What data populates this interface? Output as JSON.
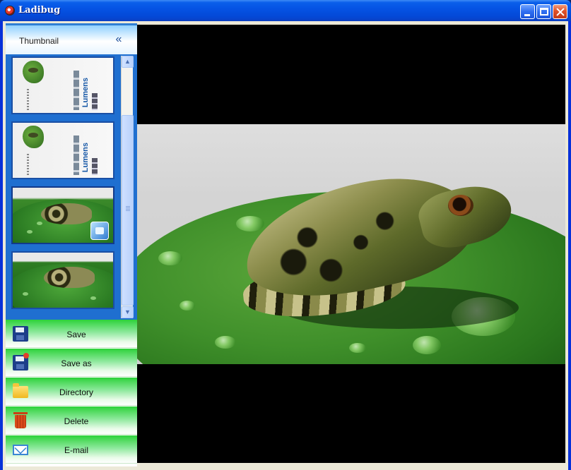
{
  "window": {
    "title": "Ladibug"
  },
  "thumbnail_panel": {
    "header_label": "Thumbnail",
    "collapse_icon": "double-chevron-left-icon",
    "thumbnails": [
      {
        "kind": "brochure",
        "brand_text": "Lumens"
      },
      {
        "kind": "brochure",
        "brand_text": "Lumens"
      },
      {
        "kind": "frog-photo",
        "badge": "camera-icon"
      },
      {
        "kind": "frog-photo"
      }
    ]
  },
  "actions": [
    {
      "label": "Save",
      "icon": "floppy-disk-icon"
    },
    {
      "label": "Save as",
      "icon": "floppy-disk-star-icon"
    },
    {
      "label": "Directory",
      "icon": "folder-icon"
    },
    {
      "label": "Delete",
      "icon": "trash-icon"
    },
    {
      "label": "E-mail",
      "icon": "envelope-icon"
    }
  ],
  "colors": {
    "title_bar": "#0553e4",
    "panel_blue": "#1f6fd0",
    "action_green": "#2dd23a",
    "preview_bg": "#000000"
  }
}
